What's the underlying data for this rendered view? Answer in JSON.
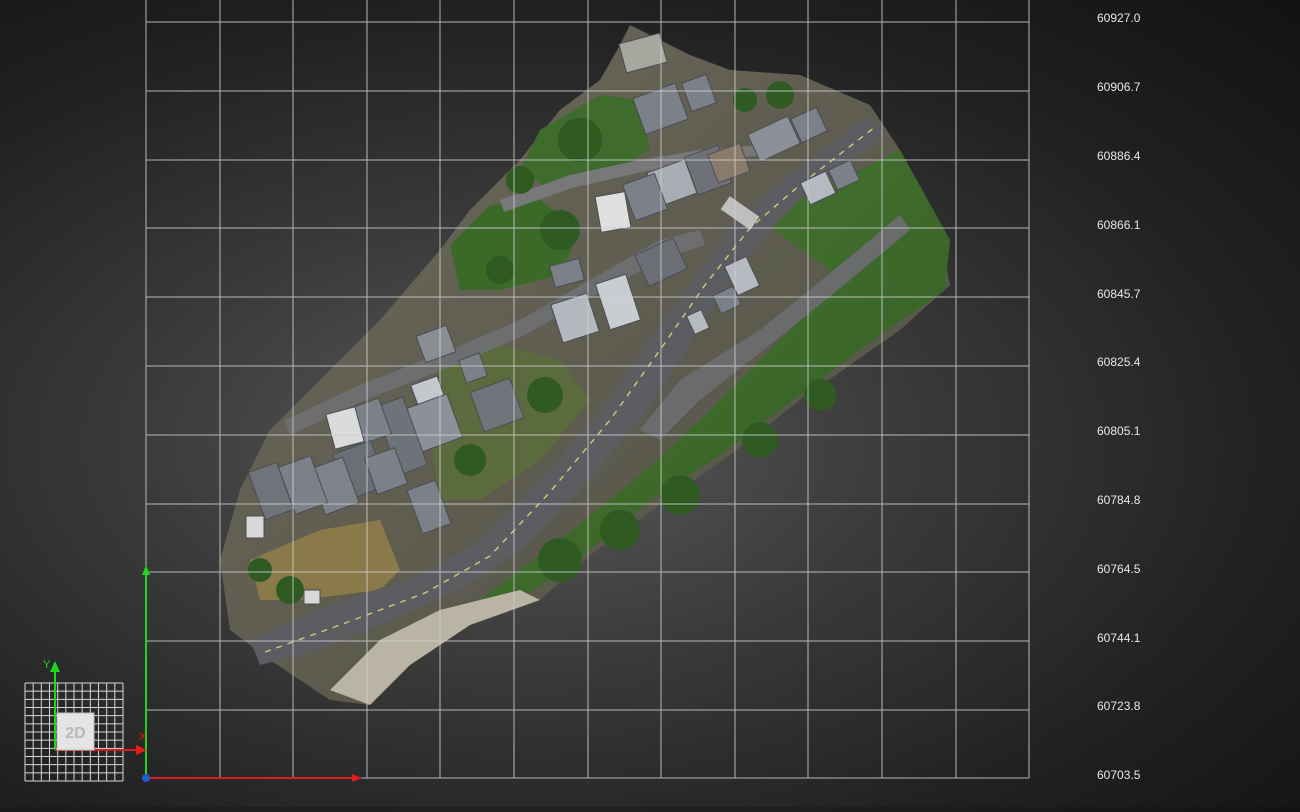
{
  "view": {
    "mode_label": "2D",
    "axis_x_label": "X",
    "axis_y_label": "Y"
  },
  "grid": {
    "y_tick_labels": [
      "60927.0",
      "60906.7",
      "60886.4",
      "60866.1",
      "60845.7",
      "60825.4",
      "60805.1",
      "60784.8",
      "60764.5",
      "60744.1",
      "60723.8",
      "60703.5"
    ]
  },
  "colors": {
    "grid_line": "#cfcfcf",
    "axis_x": "#e01b1b",
    "axis_y": "#1ed61e",
    "origin": "#1c5ed6",
    "road": "#5b5d60",
    "grass": "#3f6f2c",
    "roof": "#7c8088"
  }
}
